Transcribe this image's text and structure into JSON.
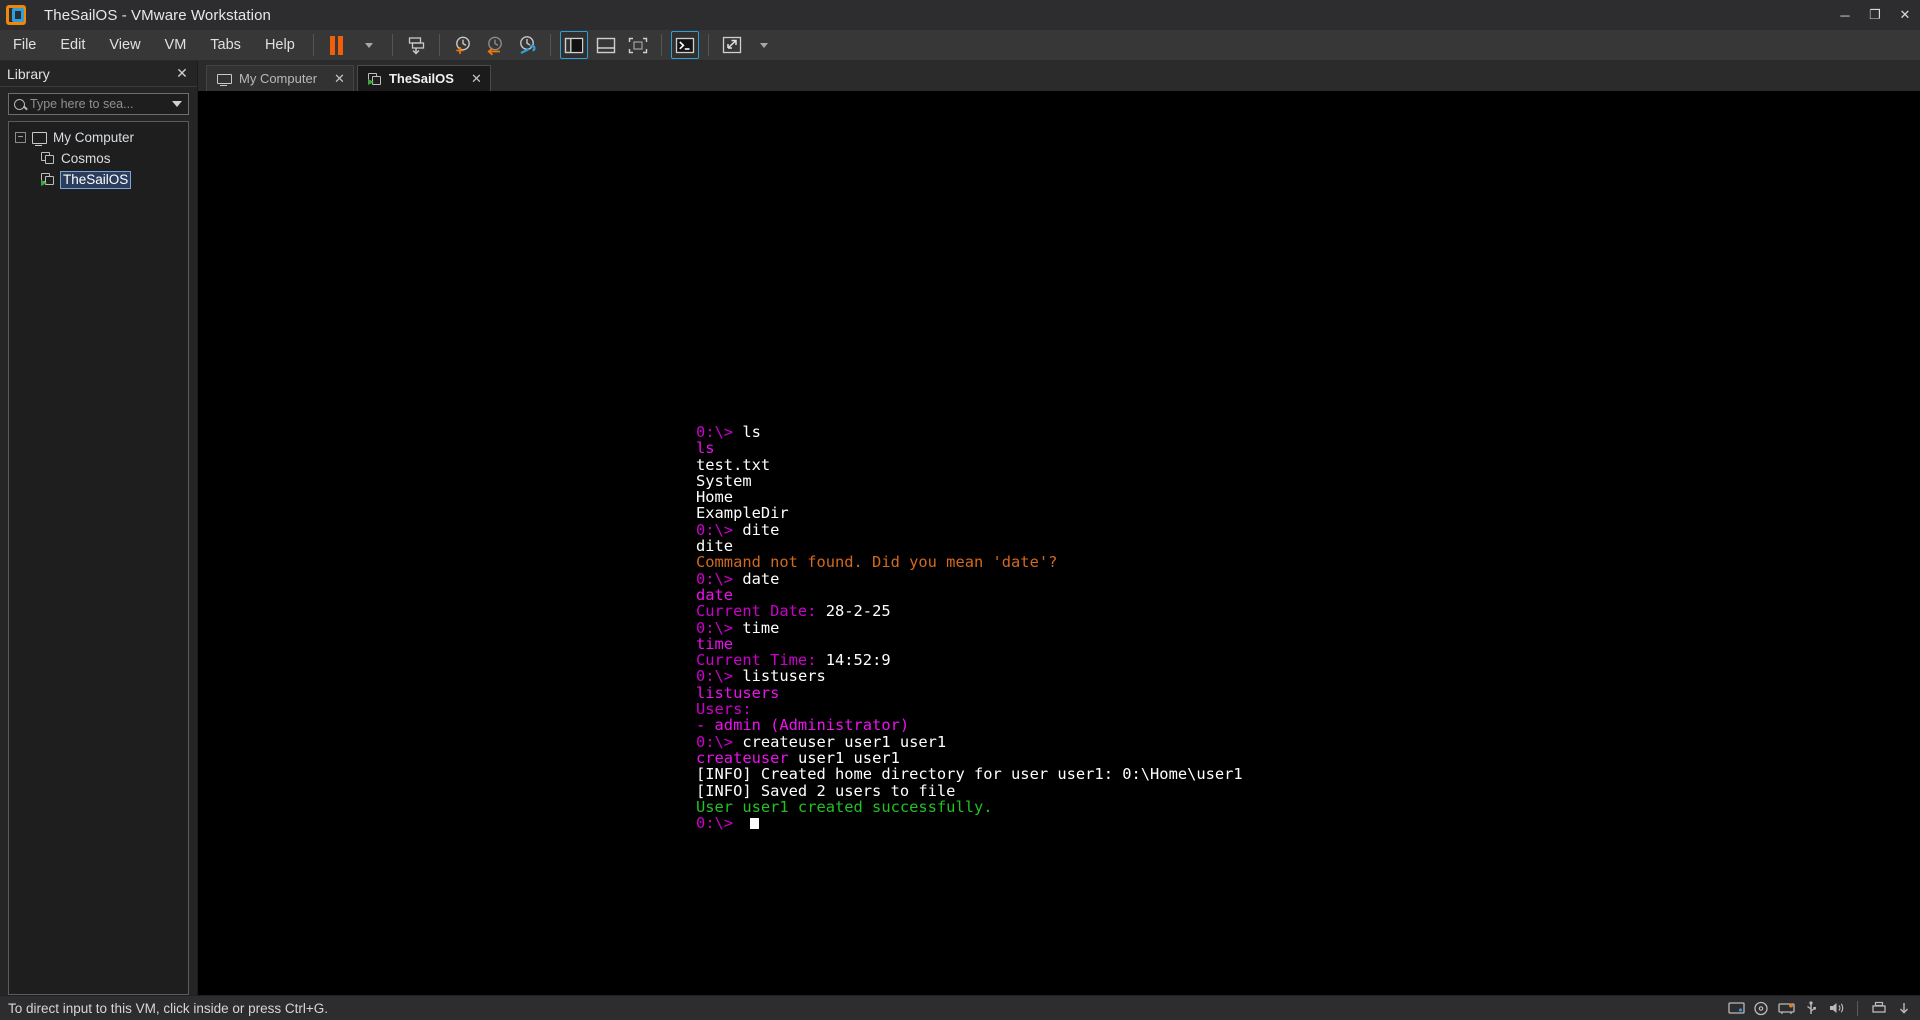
{
  "window": {
    "title": "TheSailOS - VMware Workstation",
    "logo_icon": "vmware-logo-icon",
    "controls": {
      "minimize": "─",
      "maximize": "❐",
      "close": "✕"
    }
  },
  "menubar": {
    "items": [
      {
        "label": "File"
      },
      {
        "label": "Edit"
      },
      {
        "label": "View"
      },
      {
        "label": "VM"
      },
      {
        "label": "Tabs"
      },
      {
        "label": "Help"
      }
    ]
  },
  "toolbar": {
    "buttons": [
      {
        "name": "suspend-button",
        "icon": "pause-icon"
      },
      {
        "name": "power-dropdown-button",
        "icon": "chevron-down-icon"
      },
      {
        "name": "send-ctrl-alt-del-button",
        "icon": "send-keys-icon"
      },
      {
        "name": "take-snapshot-button",
        "icon": "snapshot-add-icon"
      },
      {
        "name": "revert-snapshot-button",
        "icon": "snapshot-revert-icon"
      },
      {
        "name": "snapshot-manager-button",
        "icon": "snapshot-manager-icon"
      },
      {
        "name": "show-library-button",
        "icon": "sidebar-panel-icon"
      },
      {
        "name": "show-thumbnail-bar-button",
        "icon": "bottom-panel-icon"
      },
      {
        "name": "fullscreen-button",
        "icon": "fullscreen-icon"
      },
      {
        "name": "console-view-button",
        "icon": "console-prompt-icon"
      },
      {
        "name": "unity-button",
        "icon": "expand-arrows-icon"
      },
      {
        "name": "unity-dropdown-button",
        "icon": "chevron-down-icon"
      }
    ]
  },
  "sidebar": {
    "title": "Library",
    "close_icon": "close-icon",
    "search": {
      "placeholder": "Type here to sea...",
      "value": "",
      "icon": "search-icon",
      "dropdown_icon": "chevron-down-icon"
    },
    "tree": [
      {
        "label": "My Computer",
        "icon": "monitor-icon",
        "expander": "−",
        "level": 1,
        "selected": false
      },
      {
        "label": "Cosmos",
        "icon": "vm-icon",
        "level": 2,
        "selected": false
      },
      {
        "label": "TheSailOS",
        "icon": "vm-running-icon",
        "level": 2,
        "selected": true
      }
    ]
  },
  "tabs": [
    {
      "label": "My Computer",
      "icon": "monitor-icon",
      "active": false,
      "close_icon": "close-icon"
    },
    {
      "label": "TheSailOS",
      "icon": "vm-running-icon",
      "active": true,
      "close_icon": "close-icon"
    }
  ],
  "console": {
    "lines": [
      {
        "segments": [
          {
            "text": "0:\\> ",
            "cls": "c-prompt"
          },
          {
            "text": "ls",
            "cls": "c-cmd"
          }
        ]
      },
      {
        "segments": [
          {
            "text": "ls",
            "cls": "c-echo"
          }
        ]
      },
      {
        "segments": [
          {
            "text": "test.txt",
            "cls": "c-out"
          }
        ]
      },
      {
        "segments": [
          {
            "text": "System",
            "cls": "c-out"
          }
        ]
      },
      {
        "segments": [
          {
            "text": "Home",
            "cls": "c-out"
          }
        ]
      },
      {
        "segments": [
          {
            "text": "ExampleDir",
            "cls": "c-out"
          }
        ]
      },
      {
        "segments": [
          {
            "text": "0:\\> ",
            "cls": "c-prompt"
          },
          {
            "text": "dite",
            "cls": "c-cmd"
          }
        ]
      },
      {
        "segments": [
          {
            "text": "dite",
            "cls": "c-out"
          }
        ]
      },
      {
        "segments": [
          {
            "text": "Command not found. Did you mean 'date'?",
            "cls": "c-err"
          }
        ]
      },
      {
        "segments": [
          {
            "text": "0:\\> ",
            "cls": "c-prompt"
          },
          {
            "text": "date",
            "cls": "c-cmd"
          }
        ]
      },
      {
        "segments": [
          {
            "text": "date",
            "cls": "c-echo"
          }
        ]
      },
      {
        "segments": [
          {
            "text": "Current Date: ",
            "cls": "c-label"
          },
          {
            "text": "28-2-25",
            "cls": "c-out"
          }
        ]
      },
      {
        "segments": [
          {
            "text": "0:\\> ",
            "cls": "c-prompt"
          },
          {
            "text": "time",
            "cls": "c-cmd"
          }
        ]
      },
      {
        "segments": [
          {
            "text": "time",
            "cls": "c-echo"
          }
        ]
      },
      {
        "segments": [
          {
            "text": "Current Time: ",
            "cls": "c-label"
          },
          {
            "text": "14:52:9",
            "cls": "c-out"
          }
        ]
      },
      {
        "segments": [
          {
            "text": "0:\\> ",
            "cls": "c-prompt"
          },
          {
            "text": "listusers",
            "cls": "c-cmd"
          }
        ]
      },
      {
        "segments": [
          {
            "text": "listusers",
            "cls": "c-echo"
          }
        ]
      },
      {
        "segments": [
          {
            "text": "Users:",
            "cls": "c-label"
          }
        ]
      },
      {
        "segments": [
          {
            "text": "- admin (Administrator)",
            "cls": "c-echo"
          }
        ]
      },
      {
        "segments": [
          {
            "text": "0:\\> ",
            "cls": "c-prompt"
          },
          {
            "text": "createuser user1 user1",
            "cls": "c-cmd"
          }
        ]
      },
      {
        "segments": [
          {
            "text": "createuser ",
            "cls": "c-echo"
          },
          {
            "text": "user1 user1",
            "cls": "c-out"
          }
        ]
      },
      {
        "segments": [
          {
            "text": "[INFO] Created home directory for user user1: 0:\\Home\\user1",
            "cls": "c-out"
          }
        ]
      },
      {
        "segments": [
          {
            "text": "[INFO] Saved 2 users to file",
            "cls": "c-out"
          }
        ]
      },
      {
        "segments": [
          {
            "text": "User user1 created successfully.",
            "cls": "c-ok"
          }
        ]
      },
      {
        "segments": [
          {
            "text": "0:\\> ",
            "cls": "c-prompt"
          }
        ],
        "cursor": true
      }
    ]
  },
  "statusbar": {
    "message": "To direct input to this VM, click inside or press Ctrl+G.",
    "tray": [
      {
        "name": "hard-disk-icon"
      },
      {
        "name": "cd-dvd-icon"
      },
      {
        "name": "network-adapter-icon"
      },
      {
        "name": "usb-device-icon"
      },
      {
        "name": "sound-card-icon"
      },
      {
        "name": "printer-icon"
      },
      {
        "name": "message-log-icon"
      }
    ]
  }
}
